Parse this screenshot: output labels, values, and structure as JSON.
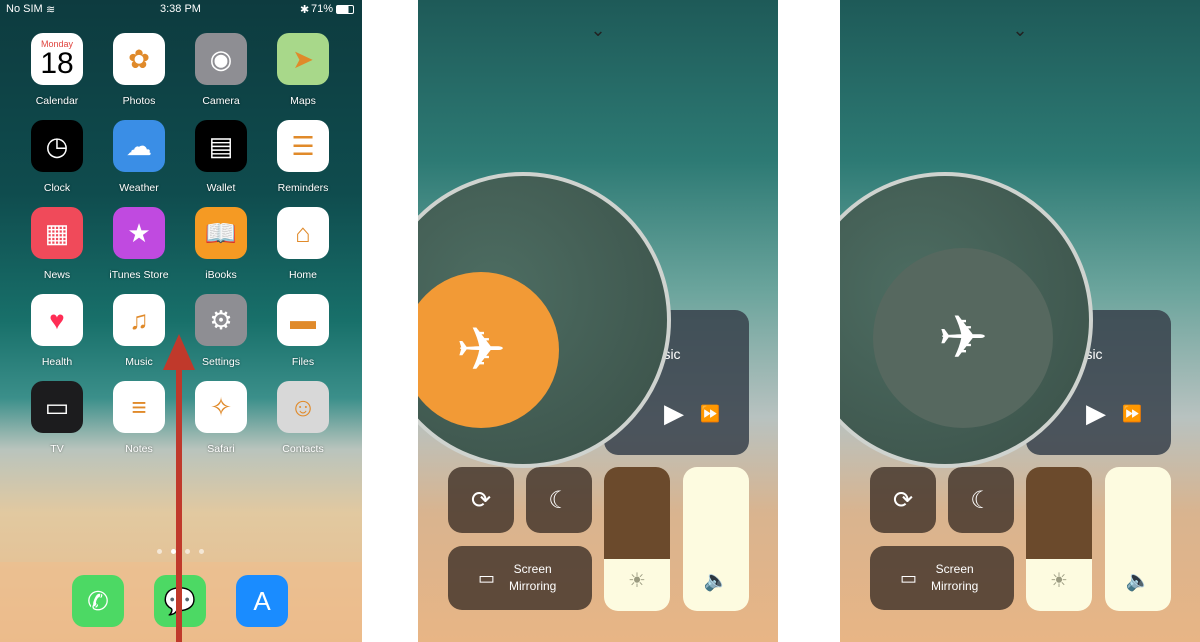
{
  "status": {
    "carrier": "No SIM",
    "time": "3:38 PM",
    "battery": "71%"
  },
  "apps": [
    {
      "label": "Calendar",
      "icon": "calendar-icon",
      "day": "Monday",
      "date": "18",
      "color": "#ffffff"
    },
    {
      "label": "Photos",
      "icon": "photos-icon",
      "color": "#ffffff"
    },
    {
      "label": "Camera",
      "icon": "camera-icon",
      "color": "#8e8e93"
    },
    {
      "label": "Maps",
      "icon": "maps-icon",
      "color": "#a8d88a"
    },
    {
      "label": "Clock",
      "icon": "clock-icon",
      "color": "#000000"
    },
    {
      "label": "Weather",
      "icon": "weather-icon",
      "color": "#3a8ee6"
    },
    {
      "label": "Wallet",
      "icon": "wallet-icon",
      "color": "#000000"
    },
    {
      "label": "Reminders",
      "icon": "reminders-icon",
      "color": "#ffffff"
    },
    {
      "label": "News",
      "icon": "news-icon",
      "color": "#f04a5a"
    },
    {
      "label": "iTunes Store",
      "icon": "star-icon",
      "color": "#c04ae0"
    },
    {
      "label": "iBooks",
      "icon": "book-icon",
      "color": "#f59a23"
    },
    {
      "label": "Home",
      "icon": "home-icon",
      "color": "#ffffff"
    },
    {
      "label": "Health",
      "icon": "heart-icon",
      "color": "#ffffff"
    },
    {
      "label": "Music",
      "icon": "music-icon",
      "color": "#ffffff"
    },
    {
      "label": "Settings",
      "icon": "gear-icon",
      "color": "#8e8e93"
    },
    {
      "label": "Files",
      "icon": "folder-icon",
      "color": "#ffffff"
    },
    {
      "label": "TV",
      "icon": "tv-icon",
      "color": "#1c1c1e"
    },
    {
      "label": "Notes",
      "icon": "notes-icon",
      "color": "#ffffff"
    },
    {
      "label": "Safari",
      "icon": "compass-icon",
      "color": "#ffffff"
    },
    {
      "label": "Contacts",
      "icon": "contacts-icon",
      "color": "#d8d8d8"
    }
  ],
  "dock": [
    {
      "icon": "phone-icon",
      "color": "#4cd964"
    },
    {
      "icon": "messages-icon",
      "color": "#4cd964"
    },
    {
      "icon": "app-store-icon",
      "color": "#1a8cff"
    }
  ],
  "control_center": {
    "music_label": "Music",
    "screen_mirroring": [
      "Screen",
      "Mirroring"
    ],
    "brightness_percent": 36,
    "volume_percent": 100,
    "panels": [
      {
        "airplane_mode": true,
        "accent": "#f29a36"
      },
      {
        "airplane_mode": false,
        "accent": "#56685f"
      }
    ]
  }
}
